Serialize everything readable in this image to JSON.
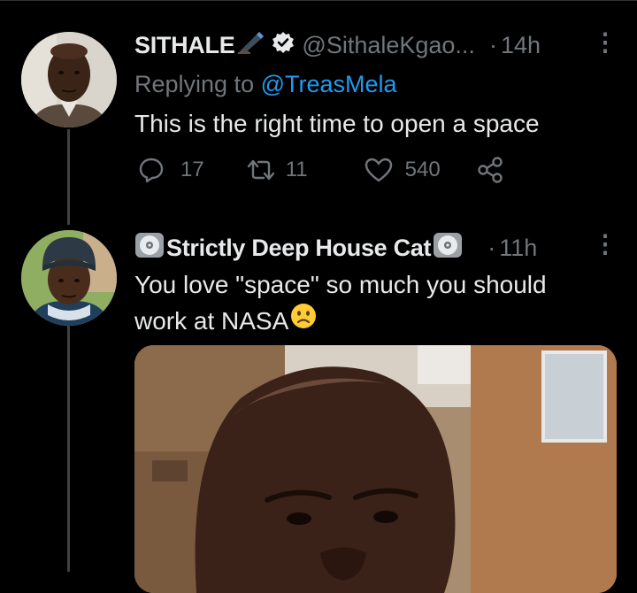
{
  "tweet1": {
    "display_name": "SITHALE",
    "name_emoji": "pen-icon",
    "verified": "verified-badge-icon",
    "handle": "@SithaleKgao...",
    "separator": "·",
    "time": "14h",
    "replying_prefix": "Replying to ",
    "replying_to": "@TreasMela",
    "text": "This is the right time to open a space",
    "replies": "17",
    "retweets": "11",
    "likes": "540"
  },
  "tweet2": {
    "name_emoji": "cd-icon",
    "display_name": "Strictly Deep House Cat",
    "separator": "·",
    "time": "11h",
    "text_line1": "You love \"space\" so much you should",
    "text_line2": "work at NASA",
    "text_emoji": "confused-face-icon",
    "media": "photo"
  },
  "colors": {
    "background": "#000000",
    "text": "#e7e9ea",
    "muted": "#71767b",
    "link": "#1d9bf0",
    "thread_line": "#3e4144"
  }
}
